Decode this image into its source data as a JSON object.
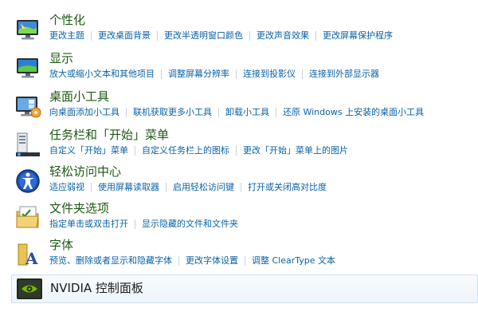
{
  "categories": [
    {
      "title": "个性化",
      "icon": "monitor-personalize-icon",
      "links": [
        "更改主题",
        "更改桌面背景",
        "更改半透明窗口颜色",
        "更改声音效果",
        "更改屏幕保护程序"
      ]
    },
    {
      "title": "显示",
      "icon": "display-monitor-icon",
      "links": [
        "放大或缩小文本和其他项目",
        "调整屏幕分辨率",
        "连接到投影仪",
        "连接到外部显示器"
      ]
    },
    {
      "title": "桌面小工具",
      "icon": "desktop-gadgets-icon",
      "links": [
        "向桌面添加小工具",
        "联机获取更多小工具",
        "卸载小工具",
        "还原 Windows 上安装的桌面小工具"
      ]
    },
    {
      "title": "任务栏和「开始」菜单",
      "icon": "taskbar-start-menu-icon",
      "links": [
        "自定义「开始」菜单",
        "自定义任务栏上的图标",
        "更改「开始」菜单上的图片"
      ]
    },
    {
      "title": "轻松访问中心",
      "icon": "ease-of-access-icon",
      "links": [
        "适应弱视",
        "使用屏幕读取器",
        "启用轻松访问键",
        "打开或关闭高对比度"
      ]
    },
    {
      "title": "文件夹选项",
      "icon": "folder-options-icon",
      "links": [
        "指定单击或双击打开",
        "显示隐藏的文件和文件夹"
      ]
    },
    {
      "title": "字体",
      "icon": "fonts-folder-icon",
      "links": [
        "预览、删除或者显示和隐藏字体",
        "更改字体设置",
        "调整 ClearType 文本"
      ]
    }
  ],
  "nvidia": {
    "title": "NVIDIA 控制面板",
    "icon": "nvidia-control-panel-icon"
  },
  "colors": {
    "title_green": "#1e5a15",
    "link_blue": "#0b62a8"
  }
}
